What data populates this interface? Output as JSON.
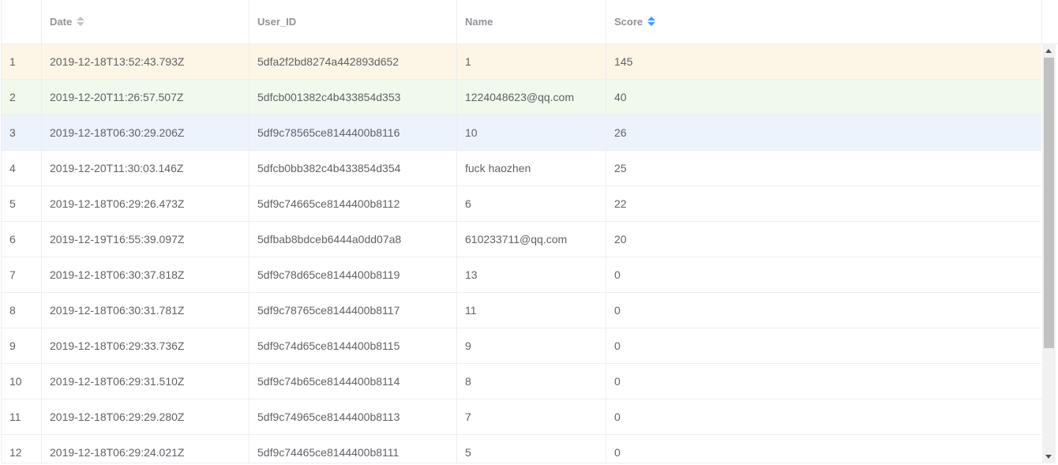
{
  "table": {
    "columns": [
      {
        "label": "",
        "sortable": false
      },
      {
        "label": "Date",
        "sortable": true,
        "sort_active": false
      },
      {
        "label": "User_ID",
        "sortable": false
      },
      {
        "label": "Name",
        "sortable": false
      },
      {
        "label": "Score",
        "sortable": true,
        "sort_active": true
      }
    ],
    "rows": [
      {
        "index": "1",
        "date": "2019-12-18T13:52:43.793Z",
        "user_id": "5dfa2f2bd8274a442893d652",
        "name": "1",
        "score": "145",
        "highlight": "warning"
      },
      {
        "index": "2",
        "date": "2019-12-20T11:26:57.507Z",
        "user_id": "5dfcb001382c4b433854d353",
        "name": "1224048623@qq.com",
        "score": "40",
        "highlight": "success"
      },
      {
        "index": "3",
        "date": "2019-12-18T06:30:29.206Z",
        "user_id": "5df9c78565ce8144400b8116",
        "name": "10",
        "score": "26",
        "highlight": "info"
      },
      {
        "index": "4",
        "date": "2019-12-20T11:30:03.146Z",
        "user_id": "5dfcb0bb382c4b433854d354",
        "name": "fuck haozhen",
        "score": "25",
        "highlight": ""
      },
      {
        "index": "5",
        "date": "2019-12-18T06:29:26.473Z",
        "user_id": "5df9c74665ce8144400b8112",
        "name": "6",
        "score": "22",
        "highlight": ""
      },
      {
        "index": "6",
        "date": "2019-12-19T16:55:39.097Z",
        "user_id": "5dfbab8bdceb6444a0dd07a8",
        "name": "610233711@qq.com",
        "score": "20",
        "highlight": ""
      },
      {
        "index": "7",
        "date": "2019-12-18T06:30:37.818Z",
        "user_id": "5df9c78d65ce8144400b8119",
        "name": "13",
        "score": "0",
        "highlight": ""
      },
      {
        "index": "8",
        "date": "2019-12-18T06:30:31.781Z",
        "user_id": "5df9c78765ce8144400b8117",
        "name": "11",
        "score": "0",
        "highlight": ""
      },
      {
        "index": "9",
        "date": "2019-12-18T06:29:33.736Z",
        "user_id": "5df9c74d65ce8144400b8115",
        "name": "9",
        "score": "0",
        "highlight": ""
      },
      {
        "index": "10",
        "date": "2019-12-18T06:29:31.510Z",
        "user_id": "5df9c74b65ce8144400b8114",
        "name": "8",
        "score": "0",
        "highlight": ""
      },
      {
        "index": "11",
        "date": "2019-12-18T06:29:29.280Z",
        "user_id": "5df9c74965ce8144400b8113",
        "name": "7",
        "score": "0",
        "highlight": ""
      },
      {
        "index": "12",
        "date": "2019-12-18T06:29:24.021Z",
        "user_id": "5df9c74465ce8144400b8111",
        "name": "5",
        "score": "0",
        "highlight": ""
      }
    ]
  },
  "colors": {
    "sort_active": "#409eff",
    "sort_inactive": "#c0c4cc",
    "row_warning": "#fdf5e6",
    "row_success": "#f0f9eb",
    "row_info": "#ecf3fd"
  }
}
